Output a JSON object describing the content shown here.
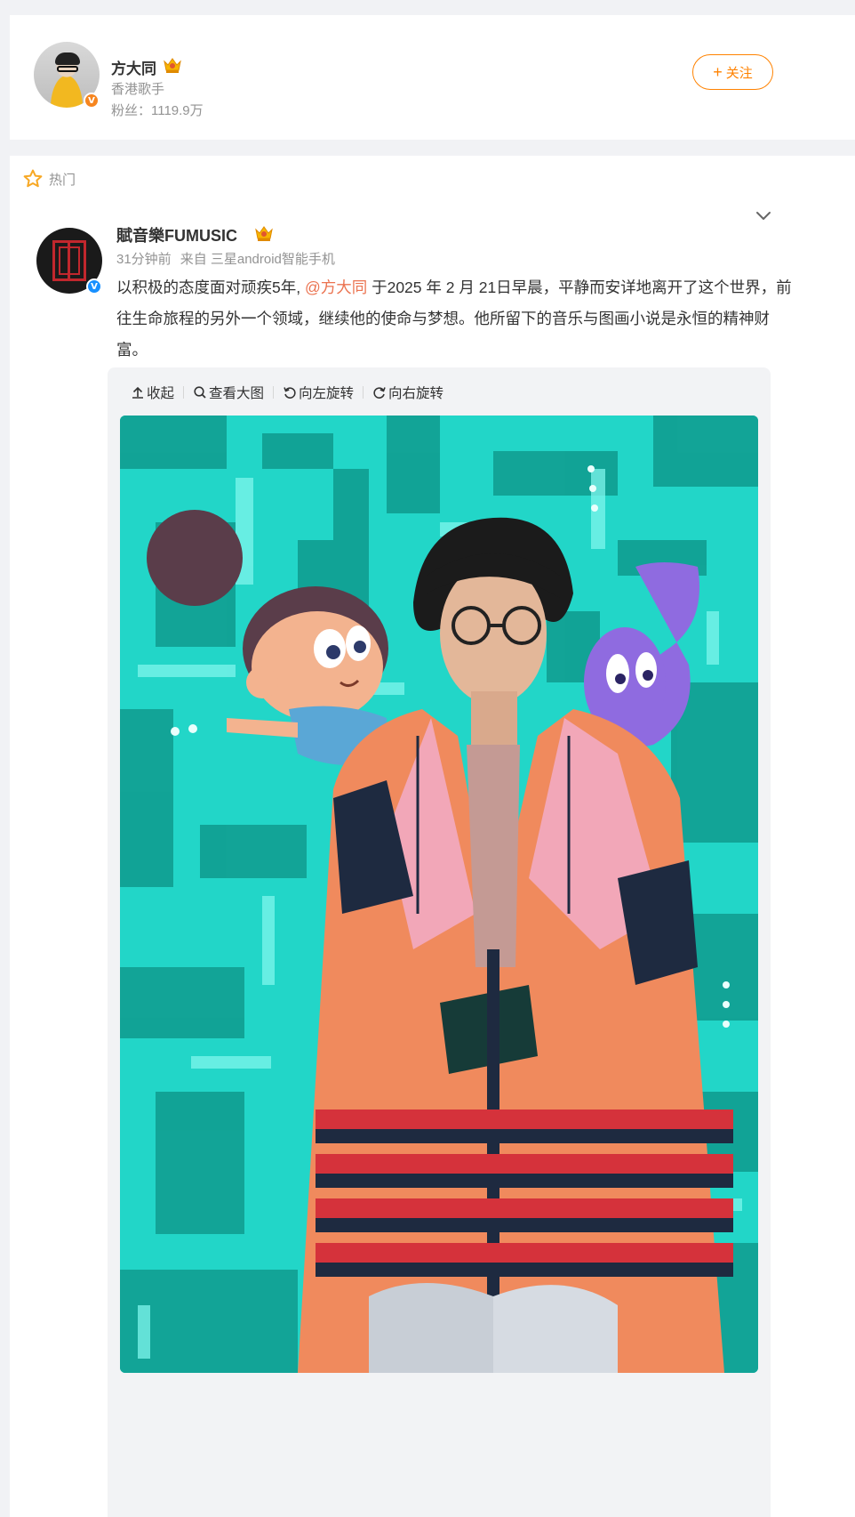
{
  "profile": {
    "name": "方大同",
    "description": "香港歌手",
    "fans": "粉丝：1119.9万",
    "verified_badge": "V",
    "follow_label": "关注",
    "follow_plus": "+"
  },
  "post": {
    "hot_label": "热门",
    "author": "賦音樂FUMUSIC",
    "verified_badge": "V",
    "time": "31分钟前",
    "source": "来自 三星android智能手机",
    "text_before": "以积极的态度面对顽疾5年, ",
    "mention": "@方大同",
    "text_after": " 于2025 年 2 月 21日早晨，平静而安详地离开了这个世界，前往生命旅程的另外一个领域，继续他的使命与梦想。他所留下的音乐与图画小说是永恒的精神财富。",
    "toolbar": {
      "collapse": "收起",
      "view_large": "查看大图",
      "rotate_left": "向左旋转",
      "rotate_right": "向右旋转"
    }
  },
  "colors": {
    "accent_orange": "#ff8200",
    "mention": "#eb7350",
    "muted_text": "#939393",
    "page_bg": "#f1f2f5"
  },
  "icons": [
    "crown-icon",
    "star-icon",
    "chevron-down-icon",
    "upload-arrow-icon",
    "magnifier-icon",
    "rotate-left-icon",
    "rotate-right-icon"
  ]
}
